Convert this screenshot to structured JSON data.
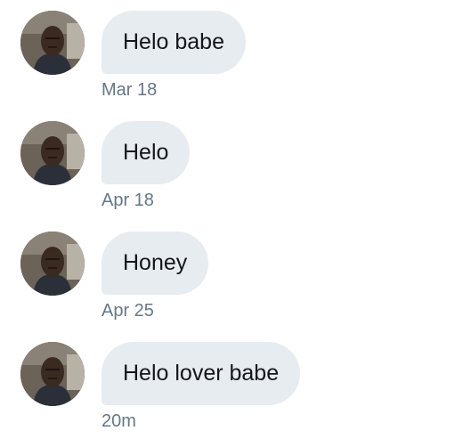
{
  "conversation": {
    "messages": [
      {
        "text": "Helo babe",
        "time": "Mar 18"
      },
      {
        "text": "Helo",
        "time": "Apr 18"
      },
      {
        "text": "Honey",
        "time": "Apr 25"
      },
      {
        "text": "Helo lover babe",
        "time": "20m"
      }
    ]
  },
  "colors": {
    "bubble_background": "#e6ecf0",
    "message_text": "#14171a",
    "timestamp_text": "#657786"
  }
}
